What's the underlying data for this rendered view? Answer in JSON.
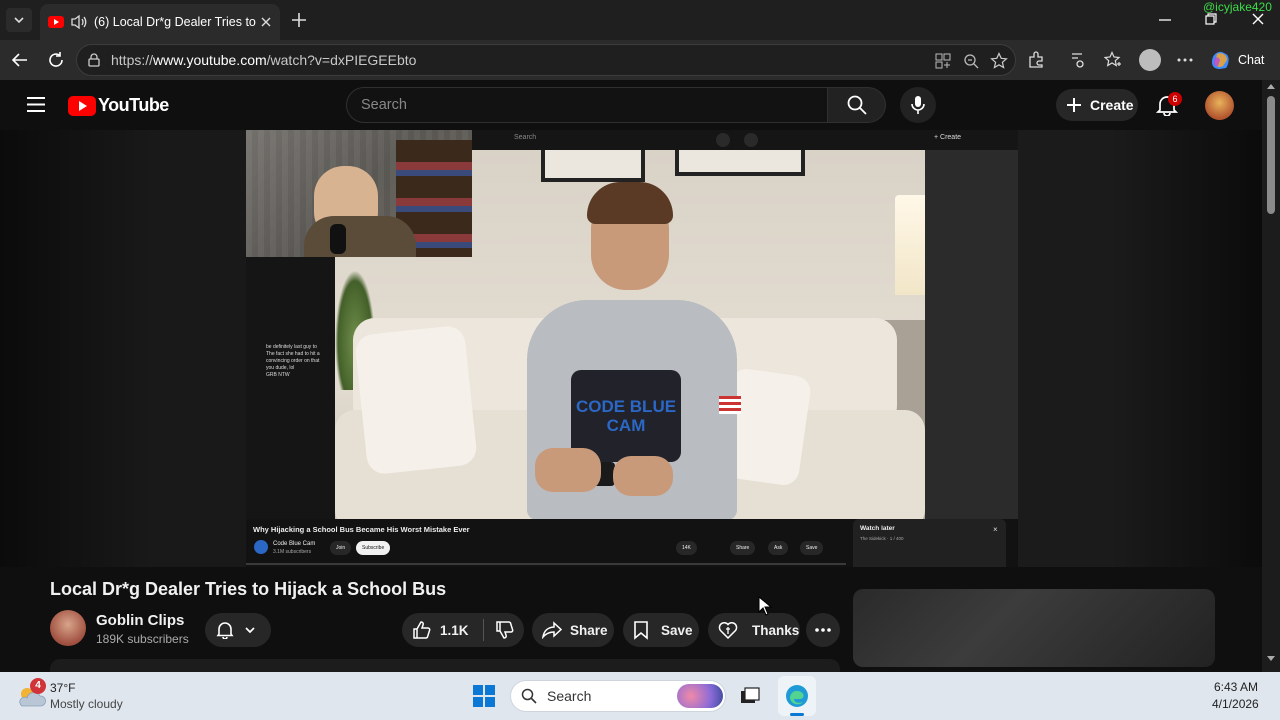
{
  "browser": {
    "tab_title": "(6) Local Dr*g Dealer Tries to",
    "url_prefix": "https://",
    "url_domain": "www.youtube.com",
    "url_path": "/watch?v=dxPIEGEEbto",
    "chat_label": "Chat",
    "watermark": "@icyjake420"
  },
  "youtube": {
    "logo_text": "YouTube",
    "search_placeholder": "Search",
    "create_label": "Create",
    "notification_count": "6"
  },
  "player_overlay": {
    "inner_search": "Search",
    "inner_video_title": "Why Hijacking a School Bus Became His Worst Mistake Ever",
    "inner_channel": "Code Blue Cam",
    "inner_subs": "3.1M subscribers",
    "inner_join": "Join",
    "inner_subscribe": "Subscribe",
    "inner_likes": "14K",
    "inner_share": "Share",
    "inner_ask": "Ask",
    "inner_save": "Save",
    "watch_later_title": "Watch later",
    "watch_later_sub": "The Sidekick · 1 / 400",
    "shirt_text": "CODE BLUE CAM",
    "chat_lines": [
      "be definitely last guy to",
      "The fact she had to hit a",
      "convincing order on that",
      "you dude, lol",
      "GRB NTW"
    ]
  },
  "video": {
    "title": "Local Dr*g Dealer Tries to Hijack a School Bus",
    "channel_name": "Goblin Clips",
    "subscribers": "189K subscribers",
    "likes": "1.1K",
    "share_label": "Share",
    "save_label": "Save",
    "thanks_label": "Thanks"
  },
  "taskbar": {
    "weather_temp": "37°F",
    "weather_desc": "Mostly cloudy",
    "weather_badge": "4",
    "search_placeholder": "Search",
    "time": "6:43 AM",
    "date": "4/1/2026"
  },
  "colors": {
    "youtube_red": "#ff0000",
    "notification_red": "#cc0000",
    "chrome_dark": "#1f1f1f",
    "watermark_green": "#3ddc48"
  }
}
